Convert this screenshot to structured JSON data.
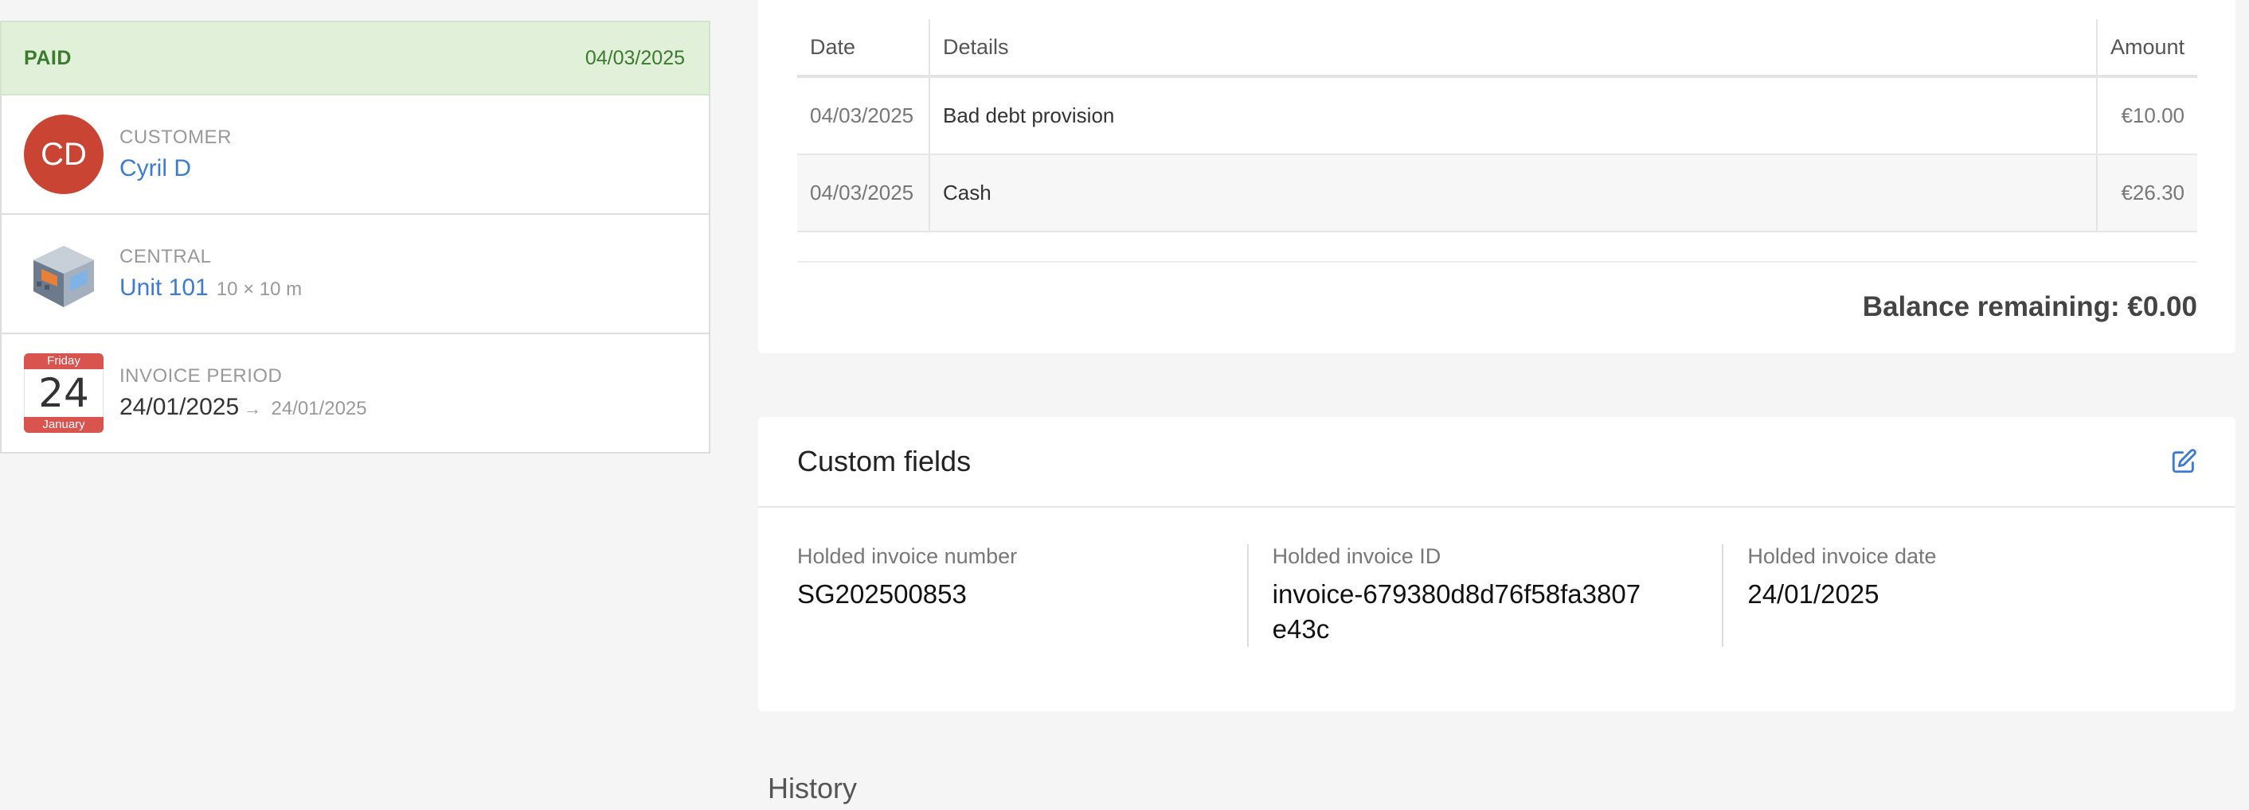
{
  "status": {
    "label": "PAID",
    "date": "04/03/2025"
  },
  "customer": {
    "initials": "CD",
    "caption": "CUSTOMER",
    "name": "Cyril D",
    "avatar_color": "#c94433"
  },
  "unit": {
    "icon": "building-icon",
    "caption": "CENTRAL",
    "name": "Unit 101",
    "size": "10 × 10 m"
  },
  "period": {
    "calendar": {
      "weekday": "Friday",
      "day": "24",
      "month": "January"
    },
    "caption": "INVOICE PERIOD",
    "start": "24/01/2025",
    "arrow": "→",
    "end": "24/01/2025"
  },
  "payments": {
    "columns": {
      "date": "Date",
      "details": "Details",
      "amount": "Amount"
    },
    "rows": [
      {
        "date": "04/03/2025",
        "details": "Bad debt provision",
        "amount": "€10.00"
      },
      {
        "date": "04/03/2025",
        "details": "Cash",
        "amount": "€26.30"
      }
    ],
    "balance": "Balance remaining: €0.00"
  },
  "custom_fields": {
    "title": "Custom fields",
    "edit_icon": "edit-icon",
    "fields": [
      {
        "label": "Holded invoice number",
        "value": "SG202500853"
      },
      {
        "label": "Holded invoice ID",
        "value": "invoice-679380d8d76f58fa3807e43c"
      },
      {
        "label": "Holded invoice date",
        "value": "24/01/2025"
      }
    ]
  },
  "history": {
    "title": "History"
  },
  "colors": {
    "accent": "#3b7bd4",
    "paid_bg": "#e0f0d9",
    "paid_text": "#3c7a2e",
    "calendar": "#d9534f"
  }
}
